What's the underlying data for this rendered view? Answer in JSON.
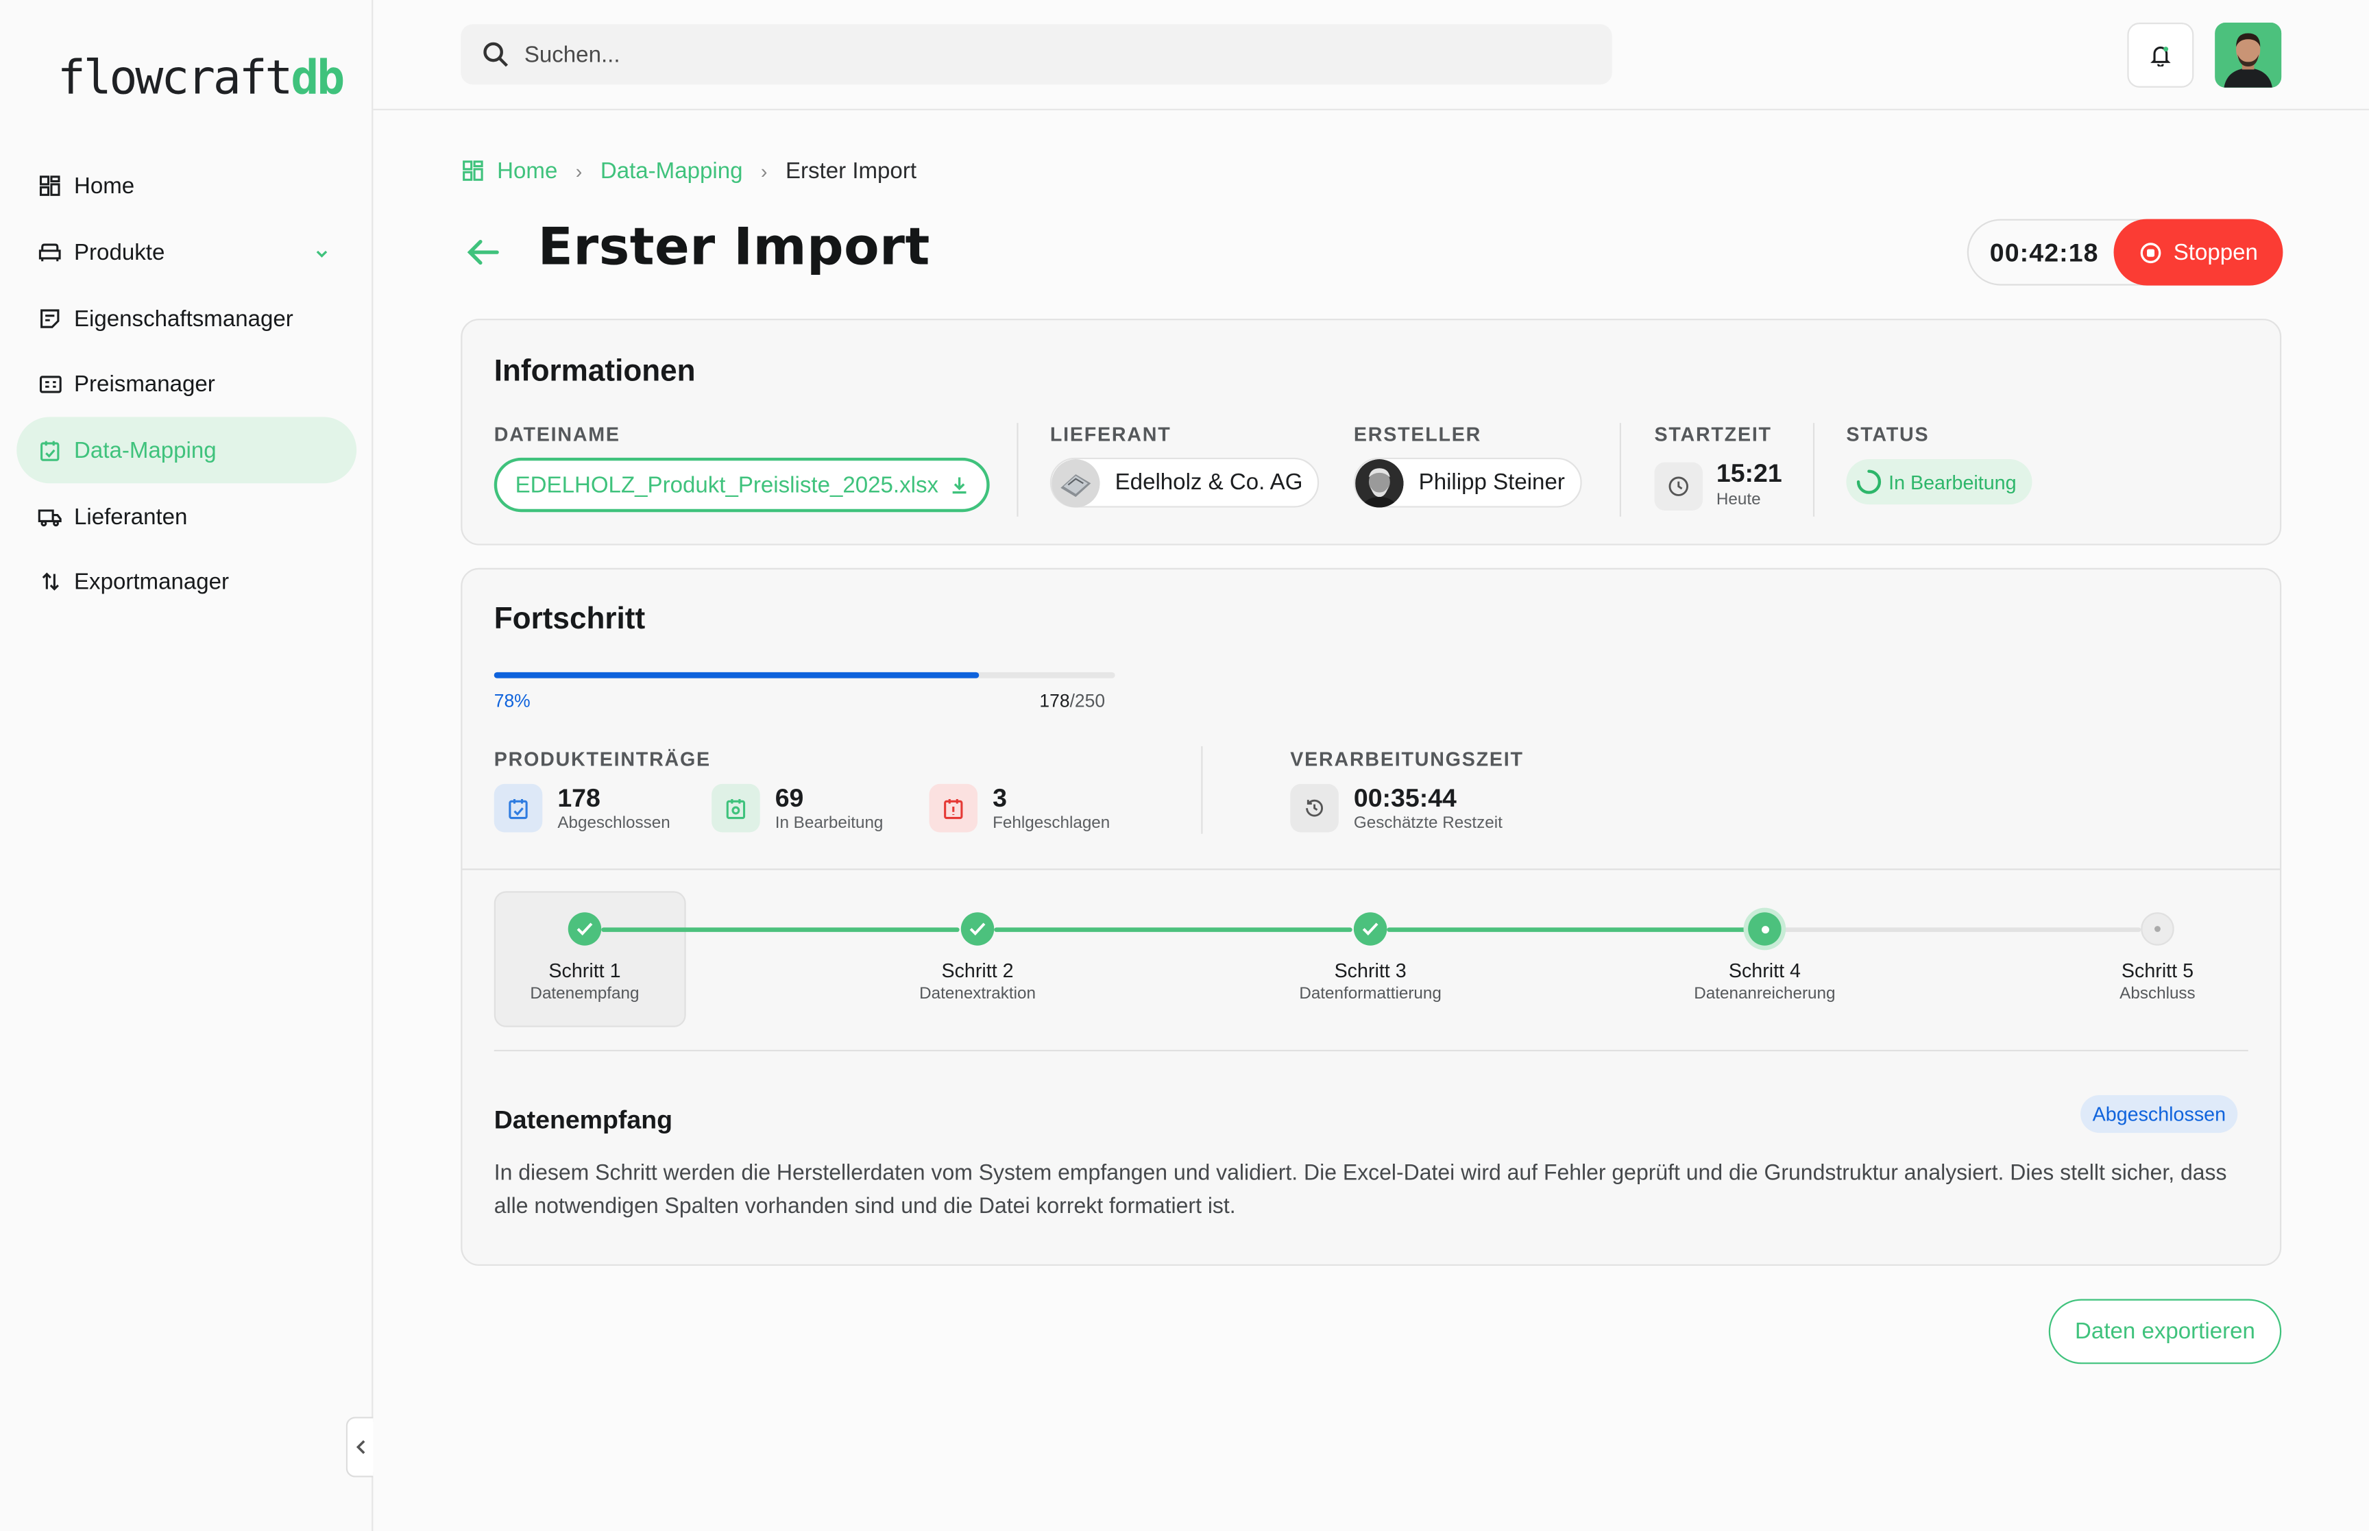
{
  "app": {
    "logo_main": "flowcraft",
    "logo_accent": "db"
  },
  "sidebar": {
    "items": [
      {
        "label": "Home",
        "icon": "dashboard-icon"
      },
      {
        "label": "Produkte",
        "icon": "sofa-icon"
      },
      {
        "label": "Eigenschaftsmanager",
        "icon": "notes-icon"
      },
      {
        "label": "Preismanager",
        "icon": "price-tag-icon"
      },
      {
        "label": "Data-Mapping",
        "icon": "clipboard-icon",
        "active": true
      },
      {
        "label": "Lieferanten",
        "icon": "truck-icon"
      },
      {
        "label": "Exportmanager",
        "icon": "arrows-updown-icon"
      }
    ]
  },
  "search": {
    "placeholder": "Suchen..."
  },
  "breadcrumb": {
    "home": "Home",
    "parent": "Data-Mapping",
    "current": "Erster Import"
  },
  "page": {
    "title": "Erster Import",
    "timer": "00:42:18",
    "stop_label": "Stoppen"
  },
  "info": {
    "title": "Informationen",
    "file_label": "DATEINAME",
    "file_name": "EDELHOLZ_Produkt_Preisliste_2025.xlsx",
    "supplier_label": "LIEFERANT",
    "supplier_name": "Edelholz & Co. AG",
    "creator_label": "ERSTELLER",
    "creator_name": "Philipp Steiner",
    "start_label": "STARTZEIT",
    "start_time": "15:21",
    "start_day": "Heute",
    "status_label": "STATUS",
    "status_value": "In Bearbeitung"
  },
  "progress": {
    "title": "Fortschritt",
    "percent": 78,
    "percent_label": "78%",
    "done": "178",
    "total": "/250",
    "entries_label": "PRODUKTEINTRÄGE",
    "stats": [
      {
        "value": "178",
        "label": "Abgeschlossen",
        "color": "#2f7ce0"
      },
      {
        "value": "69",
        "label": "In Bearbeitung",
        "color": "#3fc27c"
      },
      {
        "value": "3",
        "label": "Fehlgeschlagen",
        "color": "#e53935"
      }
    ],
    "time_label": "VERARBEITUNGSZEIT",
    "time_value": "00:35:44",
    "time_sub": "Geschätzte Restzeit"
  },
  "steps": [
    {
      "name": "Schritt 1",
      "desc": "Datenempfang",
      "state": "done"
    },
    {
      "name": "Schritt 2",
      "desc": "Datenextraktion",
      "state": "done"
    },
    {
      "name": "Schritt 3",
      "desc": "Datenformattierung",
      "state": "done"
    },
    {
      "name": "Schritt 4",
      "desc": "Datenanreicherung",
      "state": "current"
    },
    {
      "name": "Schritt 5",
      "desc": "Abschluss",
      "state": "pending"
    }
  ],
  "detail": {
    "title": "Datenempfang",
    "badge": "Abgeschlossen",
    "text": "In diesem Schritt werden die Herstellerdaten vom System empfangen und validiert. Die Excel-Datei wird auf Fehler geprüft und die Grundstruktur analysiert. Dies stellt sicher, dass alle notwendigen Spalten vorhanden sind und die Datei korrekt formatiert ist."
  },
  "export_label": "Daten exportieren",
  "colors": {
    "accent": "#3fc27c",
    "danger": "#fb3c34",
    "progress": "#0f63dc"
  }
}
